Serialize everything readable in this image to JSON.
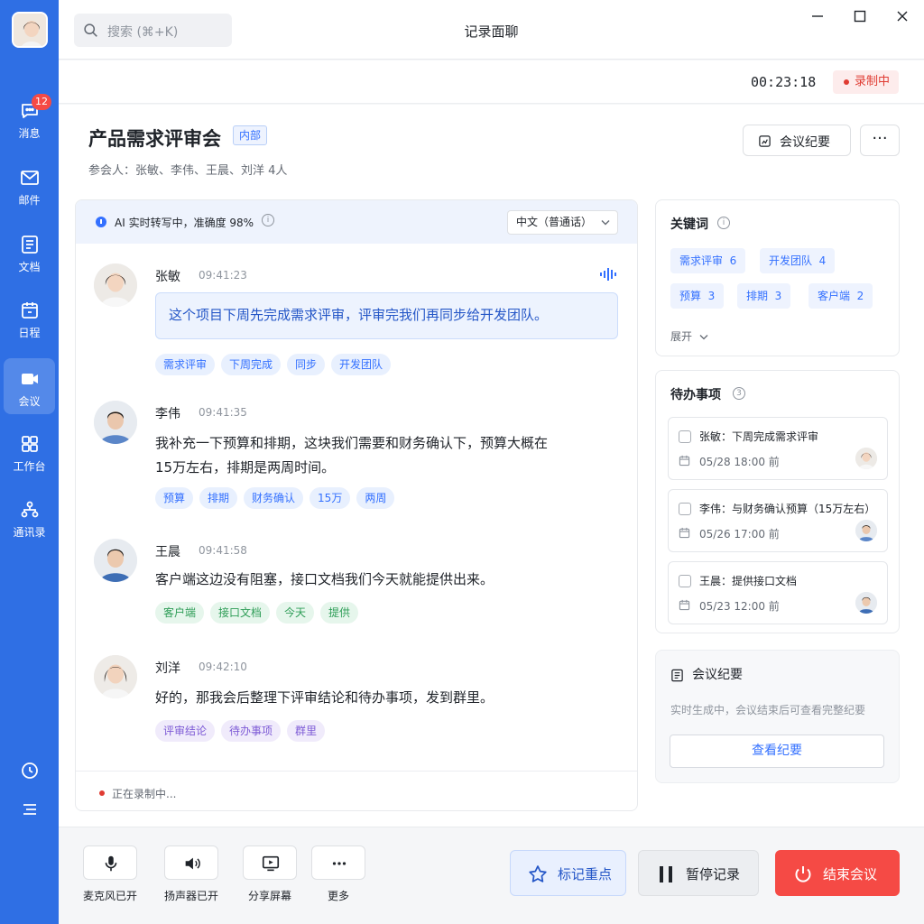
{
  "sidebar": {
    "items": [
      {
        "label": "消息",
        "badge": "12",
        "icon": "chat-bubble-icon"
      },
      {
        "label": "邮件",
        "icon": "mail-icon"
      },
      {
        "label": "文档",
        "icon": "document-icon"
      },
      {
        "label": "日程",
        "icon": "calendar-icon"
      },
      {
        "label": "会议",
        "icon": "video-camera-icon",
        "active": true
      },
      {
        "label": "工作台",
        "icon": "grid-apps-icon"
      },
      {
        "label": "通讯录",
        "icon": "contacts-icon"
      }
    ]
  },
  "titlebar": {
    "search_placeholder": "搜索 (⌘+K)",
    "title": "记录面聊"
  },
  "status": {
    "timer": "00:23:18",
    "recording_label": "录制中"
  },
  "meeting": {
    "title": "产品需求评审会",
    "tag": "内部",
    "participants": "参会人：张敏、李伟、王晨、刘洋 4人",
    "summary_button": "会议纪要",
    "more_button": "···"
  },
  "transcript": {
    "ai_status": "AI 实时转写中，准确度 98%",
    "info_glyph": "i",
    "language": "中文（普通话）",
    "footer": "正在录制中...",
    "messages": [
      {
        "name": "张敏",
        "time": "09:41:23",
        "text": "这个项目下周先完成需求评审，评审完我们再同步给开发团队。",
        "tags": [
          "需求评审",
          "下周完成",
          "同步",
          "开发团队"
        ]
      },
      {
        "name": "李伟",
        "time": "09:41:35",
        "line1": "我补充一下预算和排期，这块我们需要和财务确认下，预算大概在",
        "line2": "15万左右，排期是两周时间。",
        "tags": [
          "预算",
          "排期",
          "财务确认",
          "15万",
          "两周"
        ]
      },
      {
        "name": "王晨",
        "time": "09:41:58",
        "text": "客户端这边没有阻塞，接口文档我们今天就能提供出来。",
        "tags": [
          "客户端",
          "接口文档",
          "今天",
          "提供"
        ]
      },
      {
        "name": "刘洋",
        "time": "09:42:10",
        "text": "好的，那我会后整理下评审结论和待办事项，发到群里。",
        "tags": [
          "评审结论",
          "待办事项",
          "群里"
        ]
      }
    ]
  },
  "keywords": {
    "title": "关键词",
    "info_glyph": "i",
    "items": [
      {
        "label": "需求评审",
        "count": "6"
      },
      {
        "label": "开发团队",
        "count": "4"
      },
      {
        "label": "预算",
        "count": "3"
      },
      {
        "label": "排期",
        "count": "3"
      },
      {
        "label": "客户端",
        "count": "2"
      }
    ],
    "expand": "展开"
  },
  "todos": {
    "title": "待办事项",
    "count": "3",
    "items": [
      {
        "text": "张敏：下周完成需求评审",
        "date": "05/28  18:00 前"
      },
      {
        "text": "李伟：与财务确认预算（15万左右）",
        "date": "05/26  17:00 前"
      },
      {
        "text": "王晨：提供接口文档",
        "date": "05/23  12:00 前"
      }
    ]
  },
  "summary": {
    "title": "会议纪要",
    "subtitle": "实时生成中，会议结束后可查看完整纪要",
    "button": "查看纪要"
  },
  "toolbar": {
    "mic": "麦克风已开",
    "speaker": "扬声器已开",
    "share": "分享屏幕",
    "more": "更多",
    "mark": "标记重点",
    "pause": "暂停记录",
    "end": "结束会议"
  },
  "colors": {
    "sidebar": "#2f6fe4",
    "accent": "#3370ff",
    "danger": "#f54a45"
  }
}
